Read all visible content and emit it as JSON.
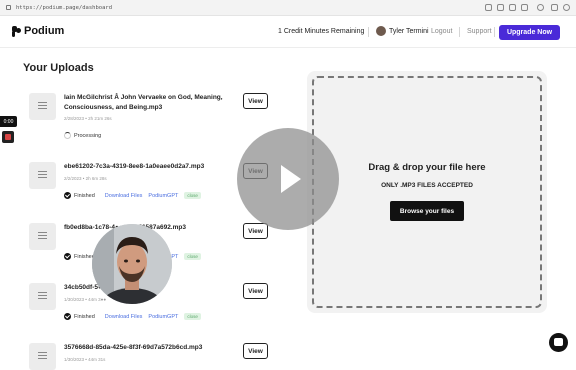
{
  "browser": {
    "url": "https://podium.page/dashboard"
  },
  "header": {
    "brand": "Podium",
    "credits": "1 Credit Minutes Remaining",
    "user_name": "Tyler Termini",
    "logout": "Logout",
    "support": "Support",
    "upgrade": "Upgrade Now"
  },
  "uploads": {
    "title": "Your Uploads",
    "view_label": "View",
    "download_label": "Download Files",
    "gpt_label": "PodiumGPT",
    "badge_label": "close",
    "items": [
      {
        "name": "Iain McGilchrist Â John Vervaeke on God, Meaning, Consciousness, and Being.mp3",
        "meta": "2/28/2023 • 2h 21m 26s",
        "status": "Processing"
      },
      {
        "name": "ebe61202-7c3a-4319-8ee8-1a0eaee0d2a7.mp3",
        "meta": "2/2/2023 • 2h 6m 28s",
        "status": "Finished"
      },
      {
        "name": "fb0ed8ba-1c78-4●●●-8f956587a692.mp3",
        "meta": "",
        "status": "Finished"
      },
      {
        "name": "34cb50df-5●●●-2b969439a.mp3",
        "meta": "1/30/2023 • 44m 3●●",
        "status": "Finished"
      },
      {
        "name": "3576668d-85da-425e-8f3f-69d7a572b6cd.mp3",
        "meta": "1/30/2023 • 44m 31s",
        "status": ""
      }
    ]
  },
  "dropzone": {
    "title": "Drag & drop your file here",
    "subtitle": "ONLY .MP3 FILES ACCEPTED",
    "button": "Browse your files"
  },
  "recorder": {
    "time": "0:00"
  }
}
